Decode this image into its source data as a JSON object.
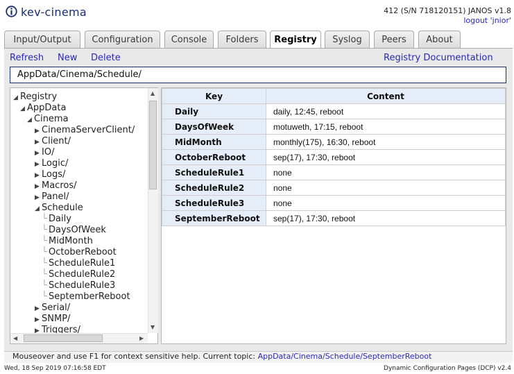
{
  "header": {
    "app_title": "kev-cinema",
    "device_info": "412 (S/N 718120151) JANOS v1.8",
    "logout": "logout 'jnior'"
  },
  "tabs": [
    {
      "label": "Input/Output"
    },
    {
      "label": "Configuration"
    },
    {
      "label": "Console"
    },
    {
      "label": "Folders"
    },
    {
      "label": "Registry"
    },
    {
      "label": "Syslog"
    },
    {
      "label": "Peers"
    },
    {
      "label": "About"
    }
  ],
  "active_tab": "Registry",
  "actions": {
    "refresh": "Refresh",
    "new": "New",
    "delete": "Delete",
    "docs": "Registry Documentation"
  },
  "path": "AppData/Cinema/Schedule/",
  "tree": [
    {
      "label": "Registry"
    },
    {
      "label": "AppData"
    },
    {
      "label": "Cinema"
    },
    {
      "label": "CinemaServerClient/"
    },
    {
      "label": "Client/"
    },
    {
      "label": "IO/"
    },
    {
      "label": "Logic/"
    },
    {
      "label": "Logs/"
    },
    {
      "label": "Macros/"
    },
    {
      "label": "Panel/"
    },
    {
      "label": "Schedule"
    },
    {
      "label": "Daily"
    },
    {
      "label": "DaysOfWeek"
    },
    {
      "label": "MidMonth"
    },
    {
      "label": "OctoberReboot"
    },
    {
      "label": "ScheduleRule1"
    },
    {
      "label": "ScheduleRule2"
    },
    {
      "label": "ScheduleRule3"
    },
    {
      "label": "SeptemberReboot"
    },
    {
      "label": "Serial/"
    },
    {
      "label": "SNMP/"
    },
    {
      "label": "Triggers/"
    }
  ],
  "table": {
    "headers": [
      "Key",
      "Content"
    ],
    "rows": [
      {
        "key": "Daily",
        "content": "daily, 12:45, reboot"
      },
      {
        "key": "DaysOfWeek",
        "content": "motuweth, 17:15, reboot"
      },
      {
        "key": "MidMonth",
        "content": "monthly(175), 16:30, reboot"
      },
      {
        "key": "OctoberReboot",
        "content": "sep(17), 17:30, reboot"
      },
      {
        "key": "ScheduleRule1",
        "content": "none"
      },
      {
        "key": "ScheduleRule2",
        "content": "none"
      },
      {
        "key": "ScheduleRule3",
        "content": "none"
      },
      {
        "key": "SeptemberReboot",
        "content": "sep(17), 17:30, reboot"
      }
    ]
  },
  "status": {
    "help_prefix": "Mouseover and use F1 for context sensitive help. Current topic:",
    "help_topic": "AppData/Cinema/Schedule/SeptemberReboot",
    "datetime": "Wed, 18 Sep 2019 07:16:58 EDT",
    "version": "Dynamic Configuration Pages (DCP) v2.4"
  },
  "colors": {
    "accent": "#1a2f6e",
    "link": "#2a2ab0",
    "header_cell": "#e5eef8"
  }
}
